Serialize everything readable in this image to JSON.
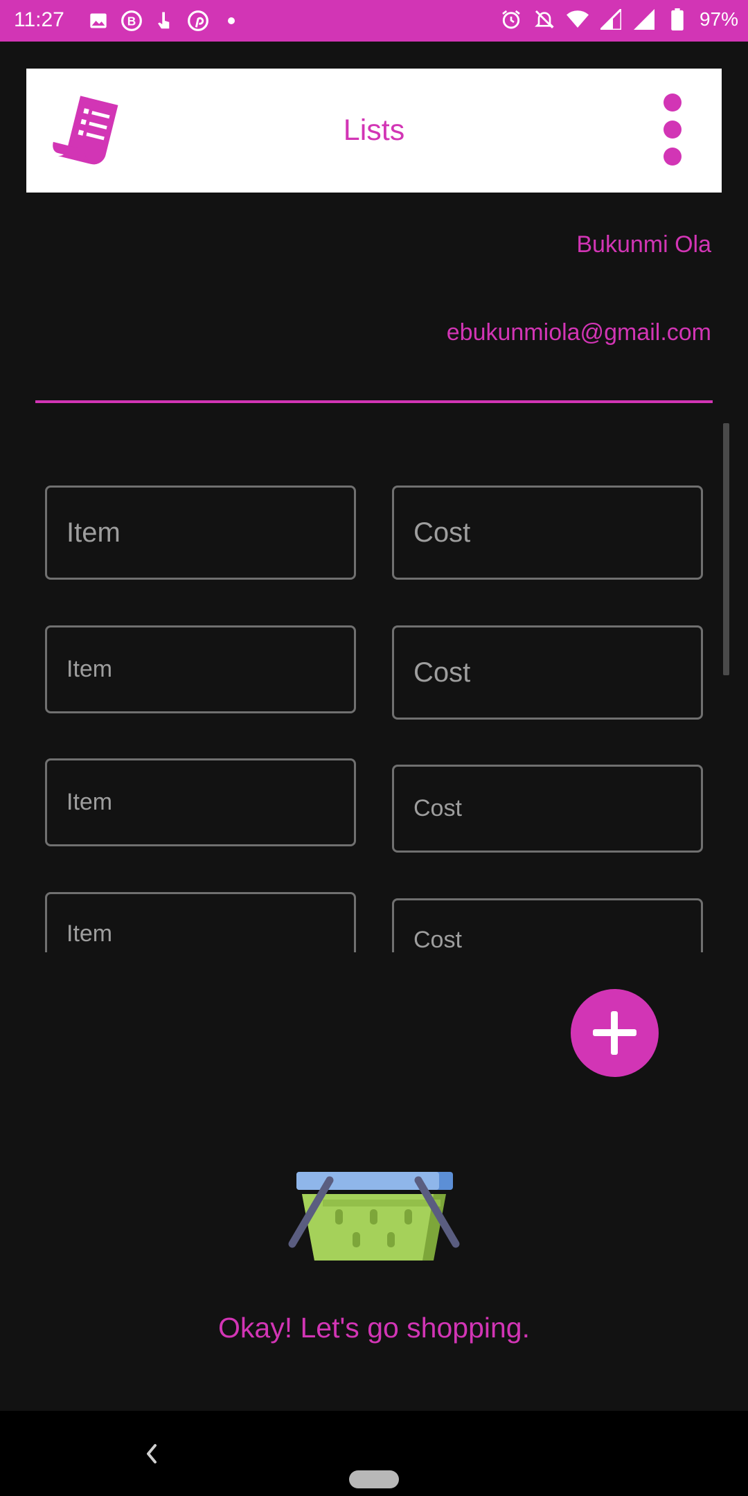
{
  "status_bar": {
    "time": "11:27",
    "battery": "97%",
    "icons_left": [
      "image-icon",
      "b-badge-icon",
      "touch-icon",
      "pinterest-icon",
      "dot-icon"
    ],
    "icons_right": [
      "alarm-icon",
      "bell-off-icon",
      "wifi-icon",
      "signal-icon",
      "signal-icon",
      "battery-icon"
    ]
  },
  "app_bar": {
    "title": "Lists",
    "logo_icon": "receipt-list-icon",
    "menu_icon": "more-vertical-icon"
  },
  "user": {
    "name": "Bukunmi Ola",
    "email": "ebukunmiola@gmail.com"
  },
  "rows": [
    {
      "item_placeholder": "Item",
      "cost_placeholder": "Cost"
    },
    {
      "item_placeholder": "Item",
      "cost_placeholder": "Cost"
    },
    {
      "item_placeholder": "Item",
      "cost_placeholder": "Cost"
    },
    {
      "item_placeholder": "Item",
      "cost_placeholder": "Cost"
    }
  ],
  "fab": {
    "icon": "plus-icon"
  },
  "empty_state": {
    "illustration": "shopping-basket-icon",
    "message": "Okay! Let's go shopping."
  },
  "colors": {
    "accent": "#d235b5",
    "background": "#121212",
    "field_border": "#707070",
    "placeholder": "#9e9e9e"
  }
}
